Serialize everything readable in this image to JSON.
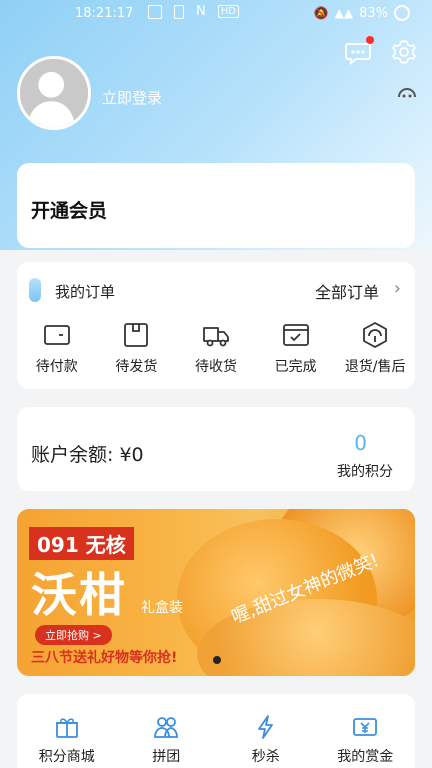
{
  "status_bar": {
    "time": "18:21:17",
    "battery": "83%",
    "hd_label": "HD"
  },
  "header": {
    "login_text": "立即登录"
  },
  "vip": {
    "title": "开通会员"
  },
  "orders": {
    "title": "我的订单",
    "all_label": "全部订单",
    "items": [
      {
        "label": "待付款",
        "icon": "wallet-icon"
      },
      {
        "label": "待发货",
        "icon": "box-icon"
      },
      {
        "label": "待收货",
        "icon": "truck-icon"
      },
      {
        "label": "已完成",
        "icon": "check-card-icon"
      },
      {
        "label": "退货/售后",
        "icon": "return-icon"
      }
    ]
  },
  "account": {
    "balance": "账户余额: ¥0",
    "points_value": "0",
    "points_label": "我的积分"
  },
  "banner": {
    "tag": "091 无核",
    "main": "沃柑",
    "sub": "礼盒装",
    "button": "立即抢购 >",
    "promo": "三八节送礼好物等你抢!",
    "slogan": "喔,甜过女神的微笑!"
  },
  "bottom_nav": {
    "items": [
      {
        "label": "积分商城",
        "icon": "gift-icon"
      },
      {
        "label": "拼团",
        "icon": "group-icon"
      },
      {
        "label": "秒杀",
        "icon": "lightning-icon"
      },
      {
        "label": "我的赏金",
        "icon": "money-icon"
      }
    ]
  },
  "colors": {
    "accent": "#5ab5ec",
    "banner_red": "#d8321f",
    "header_blue": "#8fd0f5"
  }
}
